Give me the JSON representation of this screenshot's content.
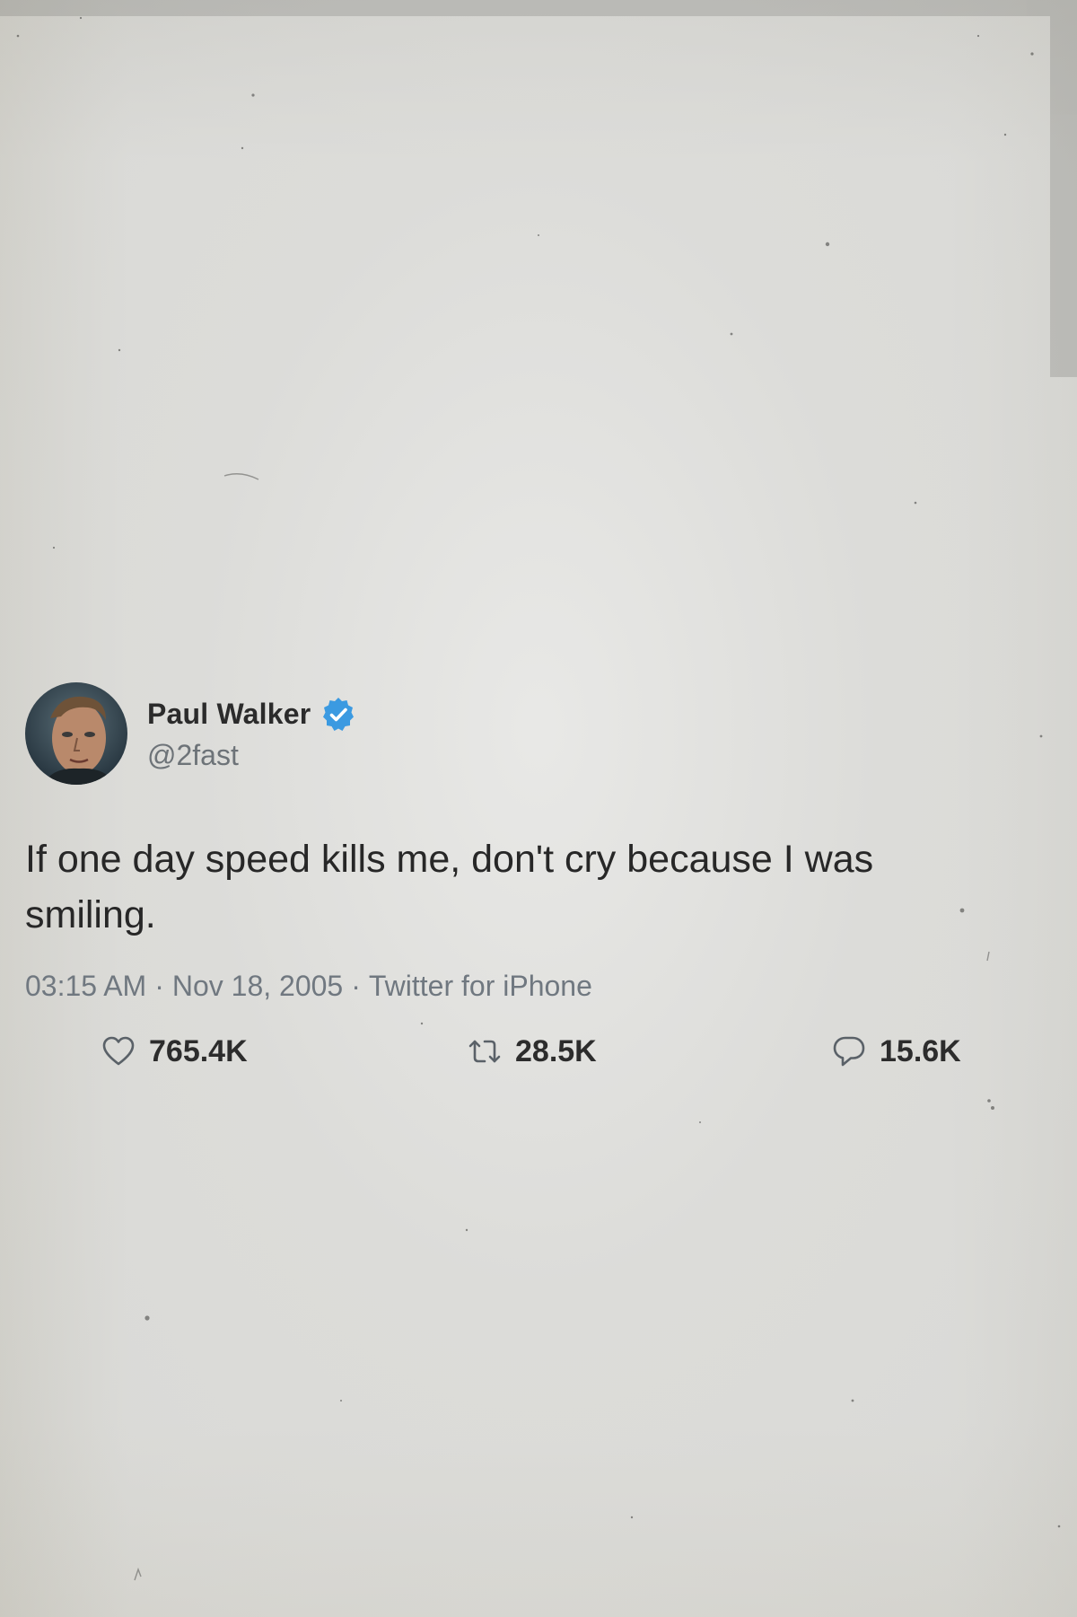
{
  "tweet": {
    "author": {
      "display_name": "Paul Walker",
      "handle": "@2fast",
      "verified": true,
      "verified_color": "#3b9ae1"
    },
    "text": "If one day speed kills me, don't cry because I was smiling.",
    "meta": {
      "time": "03:15 AM",
      "date": "Nov 18, 2005",
      "source": "Twitter for iPhone",
      "separator": "·"
    },
    "stats": {
      "likes": "765.4K",
      "retweets": "28.5K",
      "replies": "15.6K"
    }
  },
  "icons": {
    "likes": "heart-icon",
    "retweets": "retweet-icon",
    "replies": "reply-icon",
    "verified": "verified-badge-icon"
  },
  "colors": {
    "background": "#d9d9d6",
    "text": "#272727",
    "secondary_text": "#707880"
  }
}
